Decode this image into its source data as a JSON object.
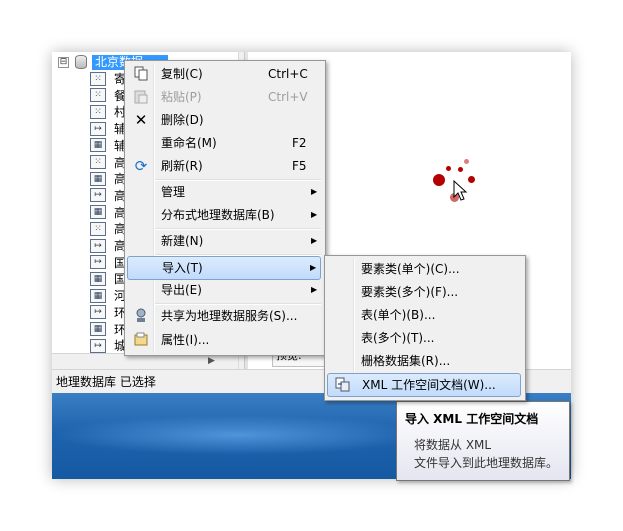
{
  "tree": {
    "root_label": "北京数据…",
    "expander": "⊟",
    "rows": [
      {
        "label": "寄",
        "icon": "point"
      },
      {
        "label": "餐",
        "icon": "point"
      },
      {
        "label": "村",
        "icon": "point"
      },
      {
        "label": "辅",
        "icon": "line"
      },
      {
        "label": "辅",
        "icon": "raster"
      },
      {
        "label": "高",
        "icon": "point"
      },
      {
        "label": "高",
        "icon": "raster"
      },
      {
        "label": "高",
        "icon": "line"
      },
      {
        "label": "高",
        "icon": "raster"
      },
      {
        "label": "高",
        "icon": "point"
      },
      {
        "label": "高",
        "icon": "line"
      },
      {
        "label": "国",
        "icon": "line"
      },
      {
        "label": "国",
        "icon": "raster"
      },
      {
        "label": "河",
        "icon": "raster"
      },
      {
        "label": "环",
        "icon": "line"
      },
      {
        "label": "环",
        "icon": "raster"
      },
      {
        "label": "城",
        "icon": "line"
      }
    ]
  },
  "status_bar": {
    "text": "地理数据库 已选择"
  },
  "preview": {
    "label": "预览:"
  },
  "context_menu": {
    "items": [
      {
        "label": "复制(C)",
        "shortcut": "Ctrl+C",
        "icon": "copy-icon"
      },
      {
        "label": "粘贴(P)",
        "shortcut": "Ctrl+V",
        "icon": "paste-icon",
        "disabled": true
      },
      {
        "label": "删除(D)",
        "icon": "delete-icon"
      },
      {
        "label": "重命名(M)",
        "shortcut": "F2"
      },
      {
        "label": "刷新(R)",
        "shortcut": "F5",
        "icon": "refresh-icon"
      },
      {
        "label": "管理",
        "submenu": true
      },
      {
        "label": "分布式地理数据库(B)",
        "submenu": true
      },
      {
        "label": "新建(N)",
        "submenu": true
      },
      {
        "label": "导入(T)",
        "submenu": true,
        "highlighted": true
      },
      {
        "label": "导出(E)",
        "submenu": true
      },
      {
        "label": "共享为地理数据服务(S)...",
        "icon": "share-service-icon"
      },
      {
        "label": "属性(I)...",
        "icon": "properties-icon"
      }
    ]
  },
  "import_submenu": {
    "items": [
      {
        "label": "要素类(单个)(C)..."
      },
      {
        "label": "要素类(多个)(F)..."
      },
      {
        "label": "表(单个)(B)..."
      },
      {
        "label": "表(多个)(T)..."
      },
      {
        "label": "栅格数据集(R)..."
      },
      {
        "label": "XML 工作空间文档(W)...",
        "highlighted": true,
        "icon": "xml-import-icon"
      }
    ]
  },
  "tooltip": {
    "title": "导入 XML 工作空间文档",
    "body_line1": "将数据从 XML",
    "body_line2": "文件导入到此地理数据库。"
  },
  "colors": {
    "selection": "#3399ff",
    "menu_bg": "#f0f0f0",
    "menu_highlight": "#c1dbfc",
    "desktop": "#1e63ad",
    "busy_dots": "#b30000"
  }
}
